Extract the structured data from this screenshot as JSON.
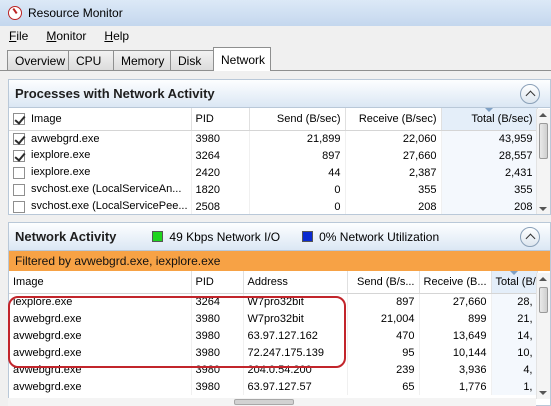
{
  "window": {
    "title": "Resource Monitor"
  },
  "menu": [
    {
      "u": "F",
      "rest": "ile"
    },
    {
      "u": "M",
      "rest": "onitor"
    },
    {
      "u": "H",
      "rest": "elp"
    }
  ],
  "tabs": [
    "Overview",
    "CPU",
    "Memory",
    "Disk",
    "Network"
  ],
  "active_tab": "Network",
  "processes_panel": {
    "title": "Processes with Network Activity",
    "columns": [
      "Image",
      "PID",
      "Send (B/sec)",
      "Receive (B/sec)",
      "Total (B/sec)"
    ],
    "rows": [
      {
        "checked": true,
        "image": "avwebgrd.exe",
        "pid": "3980",
        "send": "21,899",
        "receive": "22,060",
        "total": "43,959"
      },
      {
        "checked": true,
        "image": "iexplore.exe",
        "pid": "3264",
        "send": "897",
        "receive": "27,660",
        "total": "28,557"
      },
      {
        "checked": false,
        "image": "iexplore.exe",
        "pid": "2420",
        "send": "44",
        "receive": "2,387",
        "total": "2,431"
      },
      {
        "checked": false,
        "image": "svchost.exe (LocalServiceAn...",
        "pid": "1820",
        "send": "0",
        "receive": "355",
        "total": "355"
      },
      {
        "checked": false,
        "image": "svchost.exe (LocalServicePee...",
        "pid": "2508",
        "send": "0",
        "receive": "208",
        "total": "208"
      }
    ]
  },
  "network_panel": {
    "title": "Network Activity",
    "io_label": "49 Kbps Network I/O",
    "util_label": "0% Network Utilization",
    "io_color": "#1fd41f",
    "util_color": "#0a2ad0",
    "filter_text": "Filtered by avwebgrd.exe, iexplore.exe",
    "columns": [
      "Image",
      "PID",
      "Address",
      "Send (B/s...",
      "Receive (B...",
      "Total (B/..."
    ],
    "rows": [
      {
        "image": "iexplore.exe",
        "pid": "3264",
        "address": "W7pro32bit",
        "send": "897",
        "receive": "27,660",
        "total": "28,"
      },
      {
        "image": "avwebgrd.exe",
        "pid": "3980",
        "address": "W7pro32bit",
        "send": "21,004",
        "receive": "899",
        "total": "21,"
      },
      {
        "image": "avwebgrd.exe",
        "pid": "3980",
        "address": "63.97.127.162",
        "send": "470",
        "receive": "13,649",
        "total": "14,"
      },
      {
        "image": "avwebgrd.exe",
        "pid": "3980",
        "address": "72.247.175.139",
        "send": "95",
        "receive": "10,144",
        "total": "10,"
      },
      {
        "image": "avwebgrd.exe",
        "pid": "3980",
        "address": "204.0.54.200",
        "send": "239",
        "receive": "3,936",
        "total": "4,"
      },
      {
        "image": "avwebgrd.exe",
        "pid": "3980",
        "address": "63.97.127.57",
        "send": "65",
        "receive": "1,776",
        "total": "1,"
      }
    ]
  },
  "highlight_color": "#c2252b"
}
